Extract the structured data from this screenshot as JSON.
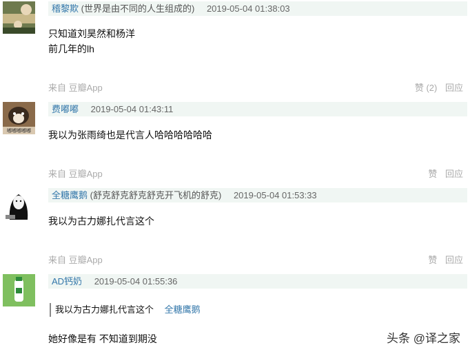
{
  "comments": [
    {
      "username": "稽黎欺",
      "signature": "(世界是由不同的人生组成的)",
      "time": "2019-05-04 01:38:03",
      "lines": [
        "只知道刘昊然和杨洋",
        "前几年的lh"
      ],
      "source": "来自 豆瓣App",
      "like": "赞 (2)",
      "reply": "回应"
    },
    {
      "username": "费嘟嘟",
      "time": "2019-05-04 01:43:11",
      "avatar_text": "嘟嘟嘟嘟嘟",
      "lines": [
        "我以为张雨绮也是代言人哈哈哈哈哈哈"
      ],
      "source": "来自 豆瓣App",
      "like": "赞",
      "reply": "回应"
    },
    {
      "username": "全糖鹰鹅",
      "signature": "(舒克舒克舒克舒克开飞机的舒克)",
      "time": "2019-05-04 01:53:33",
      "lines": [
        "我以为古力娜扎代言这个"
      ],
      "source": "来自 豆瓣App",
      "like": "赞",
      "reply": "回应"
    },
    {
      "username": "AD钙奶",
      "time": "2019-05-04 01:55:36",
      "quote_text": "我以为古力娜扎代言这个",
      "quote_author": "全糖鹰鹅",
      "lines": [
        "她好像是有 不知道到期没"
      ]
    }
  ],
  "watermark": "头条 @译之家"
}
